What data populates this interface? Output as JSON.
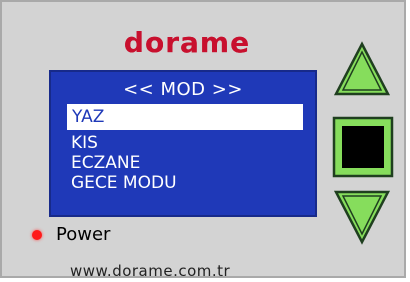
{
  "brand": {
    "logo_text": "dorame",
    "logo_color": "#c8102e"
  },
  "lcd": {
    "title": "<< MOD >>",
    "background": "#1f39b8",
    "items": [
      {
        "label": "YAZ",
        "selected": true
      },
      {
        "label": "KIS",
        "selected": false
      },
      {
        "label": "ECZANE",
        "selected": false
      },
      {
        "label": "GECE MODU",
        "selected": false
      }
    ]
  },
  "controls": {
    "up_icon": "up-triangle-icon",
    "ok_icon": "square-icon",
    "down_icon": "down-triangle-icon",
    "accent": "#7ed957"
  },
  "status": {
    "power_label": "Power",
    "led_color": "#ff1a1a"
  },
  "footer": {
    "website": "www.dorame.com.tr"
  }
}
